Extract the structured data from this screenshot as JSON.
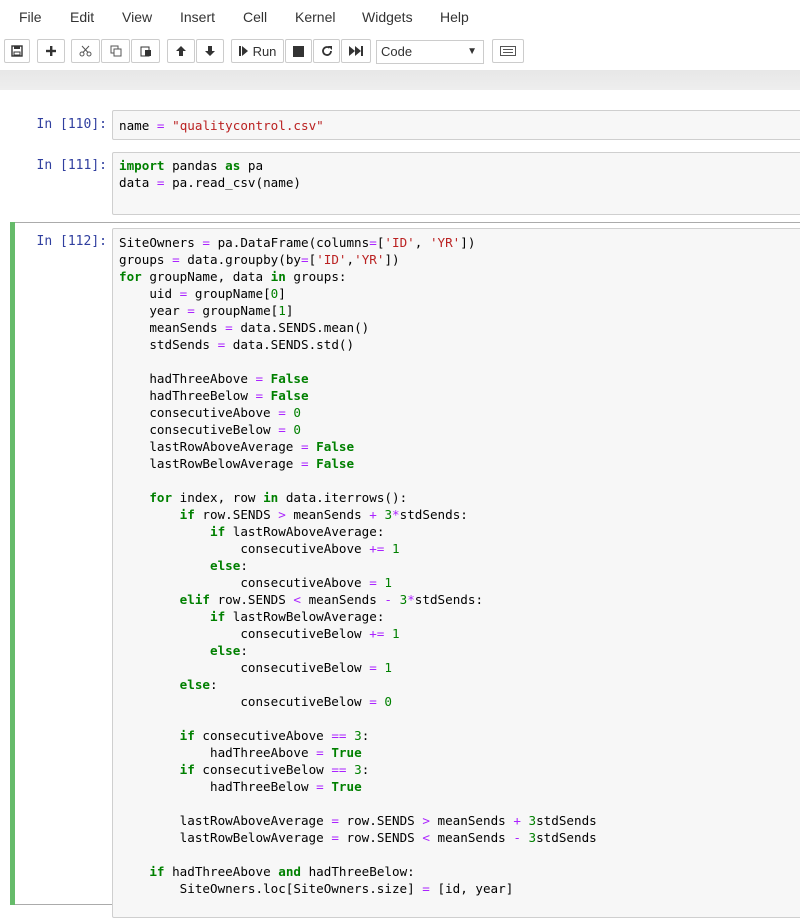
{
  "menu": {
    "items": [
      "File",
      "Edit",
      "View",
      "Insert",
      "Cell",
      "Kernel",
      "Widgets",
      "Help"
    ]
  },
  "toolbar": {
    "run_label": "Run",
    "cell_type": "Code",
    "icons": [
      "save-icon",
      "add-cell-icon",
      "cut-icon",
      "copy-icon",
      "paste-icon",
      "move-up-icon",
      "move-down-icon",
      "run-icon",
      "stop-icon",
      "restart-icon",
      "fast-forward-icon",
      "keyboard-icon"
    ]
  },
  "cells": [
    {
      "prompt": "In [110]:",
      "code": "name = \"qualitycontrol.csv\""
    },
    {
      "prompt": "In [111]:",
      "code": "import pandas as pa\ndata = pa.read_csv(name)"
    },
    {
      "prompt": "In [112]:",
      "code": "SiteOwners = pa.DataFrame(columns=['ID', 'YR'])\ngroups = data.groupby(by=['ID','YR'])\nfor groupName, data in groups:\n    uid = groupName[0]\n    year = groupName[1]\n    meanSends = data.SENDS.mean()\n    stdSends = data.SENDS.std()\n\n    hadThreeAbove = False\n    hadThreeBelow = False\n    consecutiveAbove = 0\n    consecutiveBelow = 0\n    lastRowAboveAverage = False\n    lastRowBelowAverage = False\n\n    for index, row in data.iterrows():\n        if row.SENDS > meanSends + 3*stdSends:\n            if lastRowAboveAverage:\n                consecutiveAbove += 1\n            else:\n                consecutiveAbove = 1\n        elif row.SENDS < meanSends - 3*stdSends:\n            if lastRowBelowAverage:\n                consecutiveBelow += 1\n            else:\n                consecutiveBelow = 1\n        else:\n                consecutiveBelow = 0\n\n        if consecutiveAbove == 3:\n            hadThreeAbove = True\n        if consecutiveBelow == 3:\n            hadThreeBelow = True\n\n        lastRowAboveAverage = row.SENDS > meanSends + 3stdSends\n        lastRowBelowAverage = row.SENDS < meanSends - 3stdSends\n\n    if hadThreeAbove and hadThreeBelow:\n        SiteOwners.loc[SiteOwners.size] = [id, year]"
    }
  ]
}
